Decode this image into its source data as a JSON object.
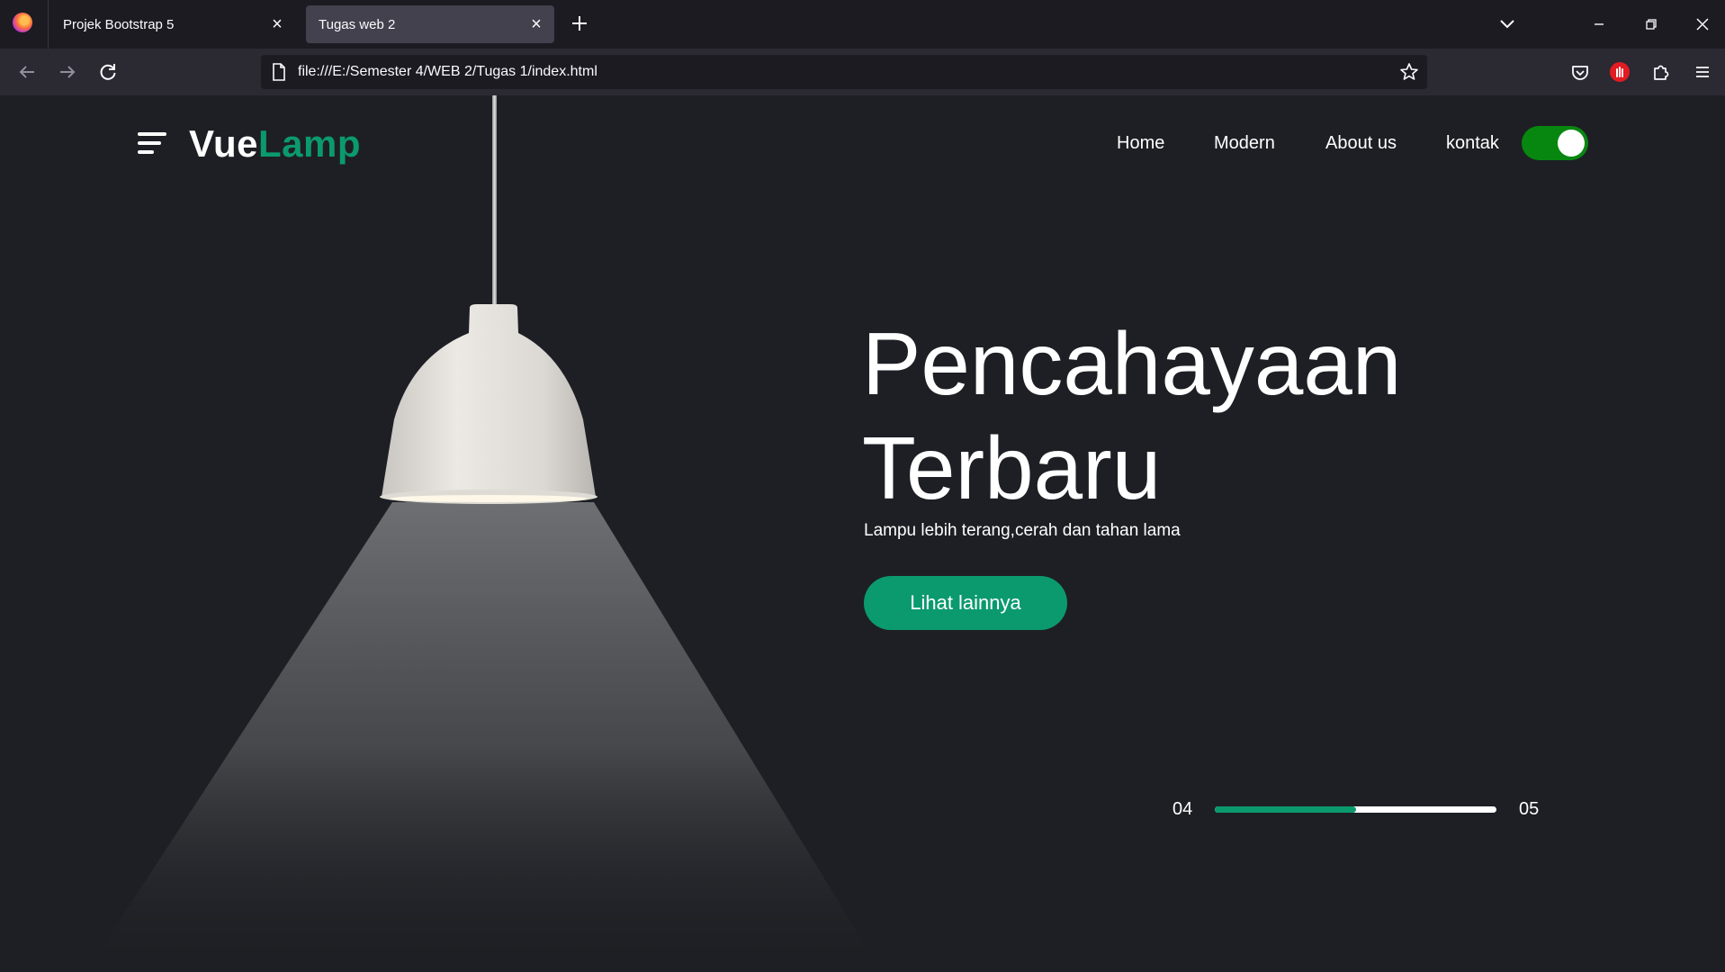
{
  "browser": {
    "tabs": [
      {
        "title": "Projek Bootstrap 5",
        "active": false
      },
      {
        "title": "Tugas web 2",
        "active": true
      }
    ],
    "url": "file:///E:/Semester 4/WEB 2/Tugas 1/index.html",
    "icons": [
      "firefox-logo-icon",
      "close-icon",
      "plus-icon",
      "chevron-down-icon",
      "minimize-icon",
      "restore-icon",
      "back-icon",
      "forward-icon",
      "reload-icon",
      "page-icon",
      "star-icon",
      "pocket-icon",
      "extension-blocker-icon",
      "extensions-icon",
      "hamburger-menu-icon"
    ]
  },
  "site": {
    "logo_part1": "Vue",
    "logo_part2": "Lamp",
    "nav": [
      "Home",
      "Modern",
      "About us",
      "kontak"
    ],
    "toggle_on": true,
    "hero": {
      "title_line1": "Pencahayaan",
      "title_line2": "Terbaru",
      "subtitle": "Lampu lebih terang,cerah dan tahan lama",
      "cta": "Lihat lainnya"
    },
    "slider": {
      "current": "04",
      "total": "05",
      "progress": 0.5
    }
  },
  "colors": {
    "accent": "#0b9a6d",
    "toggle": "#07870f",
    "page_bg": "#1e1f24",
    "chrome_bg": "#1c1b22",
    "toolbar_bg": "#2b2a33",
    "active_tab": "#42414d"
  }
}
